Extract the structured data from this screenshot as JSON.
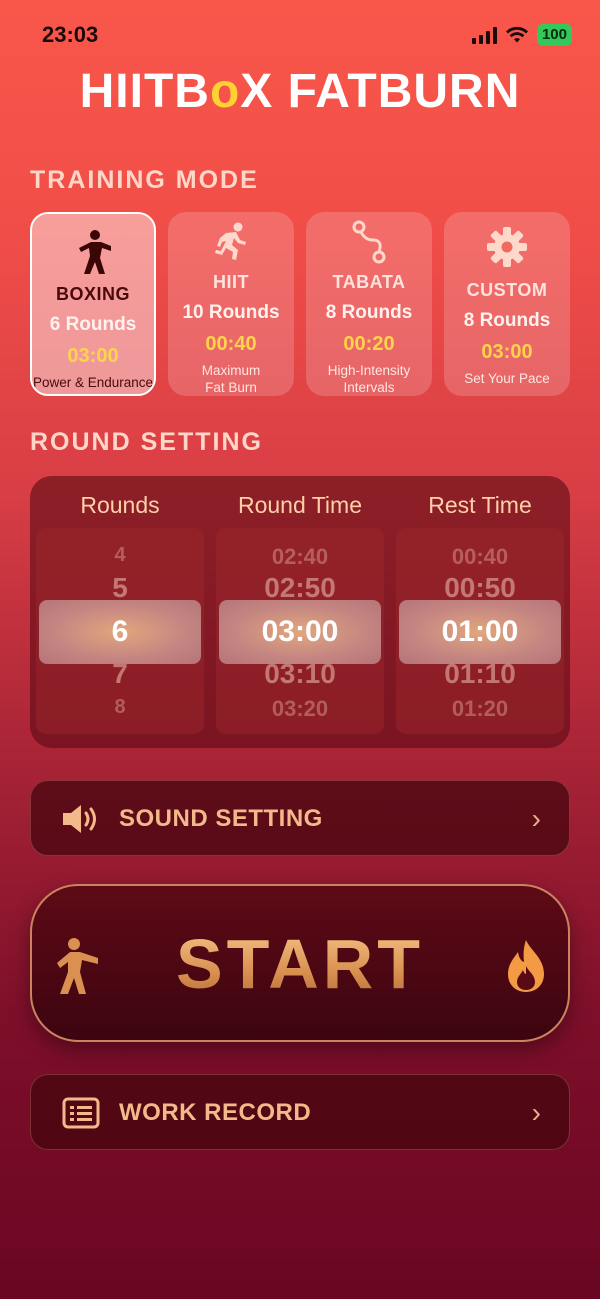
{
  "status": {
    "time": "23:03",
    "battery": "100"
  },
  "app": {
    "title_pre": "HIITB",
    "title_o": "o",
    "title_post": "X FATBURN"
  },
  "sections": {
    "training_mode": "TRAINING MODE",
    "round_setting": "ROUND SETTING"
  },
  "modes": [
    {
      "name": "BOXING",
      "rounds": "6 Rounds",
      "time": "03:00",
      "desc": "Power & Endurance",
      "icon": "boxer-icon",
      "selected": true
    },
    {
      "name": "HIIT",
      "rounds": "10 Rounds",
      "time": "00:40",
      "desc1": "Maximum",
      "desc2": "Fat Burn",
      "icon": "runner-icon"
    },
    {
      "name": "TABATA",
      "rounds": "8 Rounds",
      "time": "00:20",
      "desc1": "High-Intensity",
      "desc2": "Intervals",
      "icon": "route-icon"
    },
    {
      "name": "CUSTOM",
      "rounds": "8 Rounds",
      "time": "03:00",
      "desc": "Set Your Pace",
      "icon": "gear-icon"
    }
  ],
  "picker": {
    "rounds": {
      "label": "Rounds",
      "items": [
        "4",
        "5",
        "6",
        "7",
        "8"
      ],
      "selected": "6"
    },
    "round_time": {
      "label": "Round Time",
      "items": [
        "02:40",
        "02:50",
        "03:00",
        "03:10",
        "03:20"
      ],
      "selected": "03:00"
    },
    "rest_time": {
      "label": "Rest Time",
      "items": [
        "00:40",
        "00:50",
        "01:00",
        "01:10",
        "01:20"
      ],
      "selected": "01:00"
    }
  },
  "sound": {
    "label": "SOUND SETTING",
    "icon": "speaker-icon"
  },
  "start": {
    "label": "START",
    "left_icon": "boxer-icon",
    "right_icon": "flame-icon"
  },
  "record": {
    "label": "WORK RECORD",
    "icon": "list-icon"
  },
  "colors": {
    "accent_yellow": "#ffd44a",
    "gold": "#f3b98a"
  }
}
